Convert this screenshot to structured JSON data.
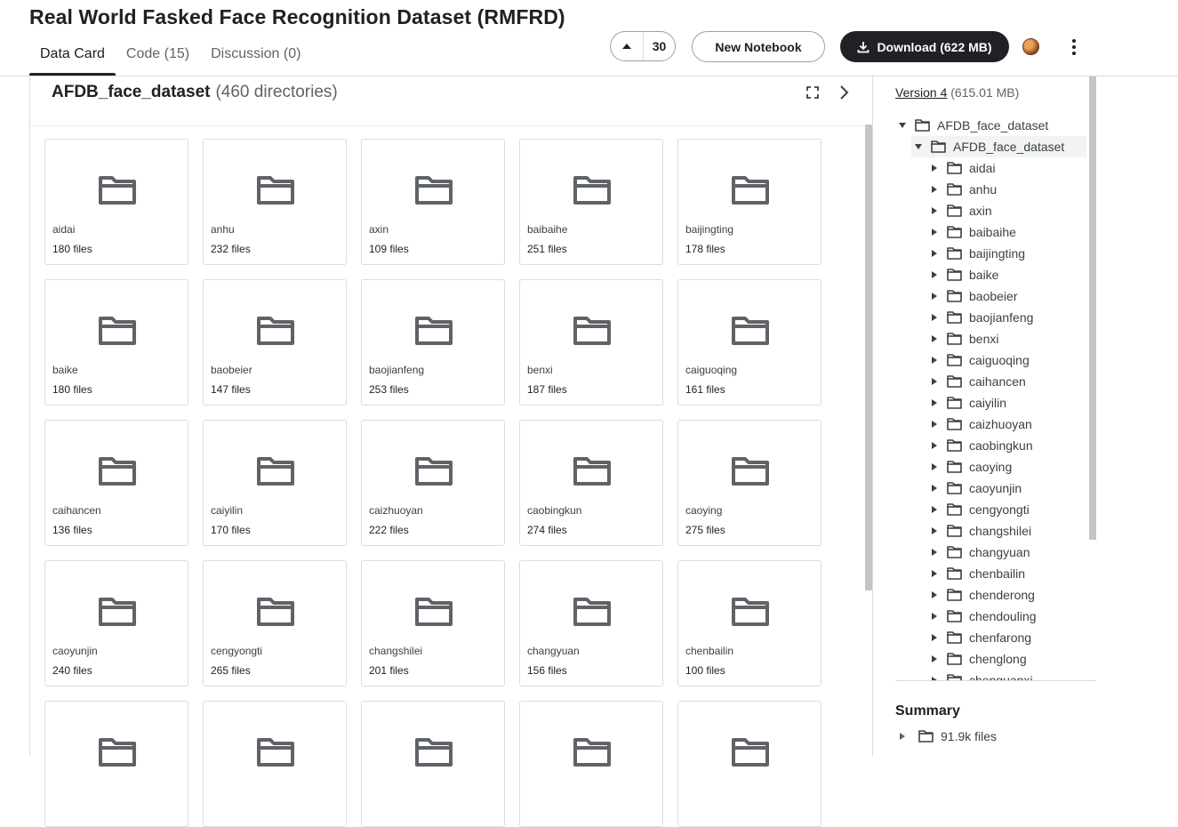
{
  "header": {
    "title": "Real World Fasked Face Recognition Dataset (RMFRD)",
    "tabs": [
      {
        "label": "Data Card",
        "active": true
      },
      {
        "label": "Code (15)",
        "active": false
      },
      {
        "label": "Discussion (0)",
        "active": false
      }
    ],
    "vote_count": "30",
    "new_notebook_label": "New Notebook",
    "download_label": "Download (622 MB)",
    "icons": [
      "upvote-icon",
      "download-icon",
      "user-avatar",
      "more-vert-icon"
    ]
  },
  "main": {
    "dataset_name": "AFDB_face_dataset",
    "directory_count": "(460 directories)",
    "folders": [
      {
        "name": "aidai",
        "files": "180 files"
      },
      {
        "name": "anhu",
        "files": "232 files"
      },
      {
        "name": "axin",
        "files": "109 files"
      },
      {
        "name": "baibaihe",
        "files": "251 files"
      },
      {
        "name": "baijingting",
        "files": "178 files"
      },
      {
        "name": "baike",
        "files": "180 files"
      },
      {
        "name": "baobeier",
        "files": "147 files"
      },
      {
        "name": "baojianfeng",
        "files": "253 files"
      },
      {
        "name": "benxi",
        "files": "187 files"
      },
      {
        "name": "caiguoqing",
        "files": "161 files"
      },
      {
        "name": "caihancen",
        "files": "136 files"
      },
      {
        "name": "caiyilin",
        "files": "170 files"
      },
      {
        "name": "caizhuoyan",
        "files": "222 files"
      },
      {
        "name": "caobingkun",
        "files": "274 files"
      },
      {
        "name": "caoying",
        "files": "275 files"
      },
      {
        "name": "caoyunjin",
        "files": "240 files"
      },
      {
        "name": "cengyongti",
        "files": "265 files"
      },
      {
        "name": "changshilei",
        "files": "201 files"
      },
      {
        "name": "changyuan",
        "files": "156 files"
      },
      {
        "name": "chenbailin",
        "files": "100 files"
      },
      {
        "name": "",
        "files": ""
      },
      {
        "name": "",
        "files": ""
      },
      {
        "name": "",
        "files": ""
      },
      {
        "name": "",
        "files": ""
      },
      {
        "name": "",
        "files": ""
      }
    ]
  },
  "sidebar": {
    "version_label": "Version 4",
    "version_size": "(615.01 MB)",
    "tree_root": "AFDB_face_dataset",
    "tree_child": "AFDB_face_dataset",
    "tree_items": [
      "aidai",
      "anhu",
      "axin",
      "baibaihe",
      "baijingting",
      "baike",
      "baobeier",
      "baojianfeng",
      "benxi",
      "caiguoqing",
      "caihancen",
      "caiyilin",
      "caizhuoyan",
      "caobingkun",
      "caoying",
      "caoyunjin",
      "cengyongti",
      "changshilei",
      "changyuan",
      "chenbailin",
      "chenderong",
      "chendouling",
      "chenfarong",
      "chenglong",
      "chenguanxi"
    ],
    "summary_title": "Summary",
    "summary_files": "91.9k files"
  }
}
